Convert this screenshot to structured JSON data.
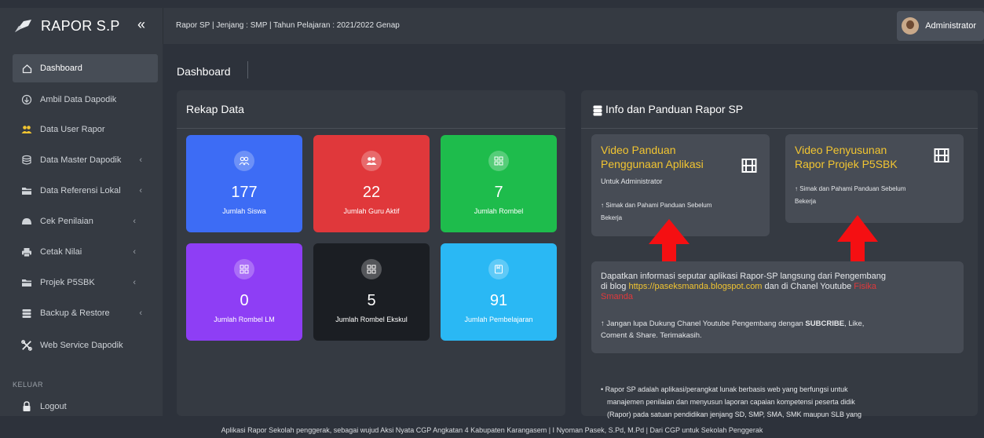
{
  "app": {
    "name": "RAPOR S.P",
    "collapse_icon": "«"
  },
  "header": {
    "info": "Rapor SP | Jenjang : SMP | Tahun Pelajaran : 2021/2022 Genap",
    "user": "Administrator"
  },
  "sidebar": {
    "items": [
      {
        "label": "Dashboard",
        "icon": "home-icon",
        "chev": ""
      },
      {
        "label": "Ambil Data Dapodik",
        "icon": "download-icon",
        "chev": ""
      },
      {
        "label": "Data User Rapor",
        "icon": "users-icon",
        "chev": ""
      },
      {
        "label": "Data Master Dapodik",
        "icon": "database-icon",
        "chev": "‹"
      },
      {
        "label": "Data Referensi Lokal",
        "icon": "folder-icon",
        "chev": "‹"
      },
      {
        "label": "Cek Penilaian",
        "icon": "check-icon",
        "chev": "‹"
      },
      {
        "label": "Cetak Nilai",
        "icon": "print-icon",
        "chev": "‹"
      },
      {
        "label": "Projek P5SBK",
        "icon": "project-icon",
        "chev": "‹"
      },
      {
        "label": "Backup & Restore",
        "icon": "backup-icon",
        "chev": "‹"
      },
      {
        "label": "Web Service Dapodik",
        "icon": "tools-icon",
        "chev": ""
      }
    ],
    "section_label": "KELUAR",
    "logout": "Logout"
  },
  "page": {
    "title": "Dashboard"
  },
  "rekap": {
    "title": "Rekap Data",
    "stats": [
      {
        "value": "177",
        "label": "Jumlah Siswa",
        "color": "#3d6cf5"
      },
      {
        "value": "22",
        "label": "Jumlah Guru Aktif",
        "color": "#e0383b"
      },
      {
        "value": "7",
        "label": "Jumlah Rombel",
        "color": "#1ebc4c"
      },
      {
        "value": "0",
        "label": "Jumlah Rombel LM",
        "color": "#8e3ef5"
      },
      {
        "value": "5",
        "label": "Jumlah Rombel Ekskul",
        "color": "#1b1e23"
      },
      {
        "value": "91",
        "label": "Jumlah Pembelajaran",
        "color": "#2ab8f4"
      }
    ]
  },
  "info": {
    "title": "Info dan Panduan Rapor SP",
    "video1": {
      "title_line1": "Video Panduan",
      "title_line2": "Penggunaan Aplikasi",
      "sub": "Untuk Administrator",
      "note_line1": "↑ Simak dan Pahami Panduan Sebelum",
      "note_line2": "Bekerja"
    },
    "video2": {
      "title_line1": "Video Penyusunan",
      "title_line2": "Rapor Projek P5SBK",
      "note_line1": "↑ Simak dan Pahami Panduan Sebelum",
      "note_line2": "Bekerja"
    },
    "blog": {
      "line1": "Dapatkan informasi seputar aplikasi Rapor-SP langsung dari Pengembang",
      "line2_pre": "di blog ",
      "link": "https://paseksmanda.blogspot.com",
      "line2_mid": " dan di Chanel Youtube ",
      "channel_1": "Fisika",
      "channel_2": "Smanda",
      "note_pre": "↑ Jangan lupa Dukung Chanel Youtube Pengembang dengan ",
      "note_bold": "SUBCRIBE",
      "note_post": ", Like,",
      "note_line2": "Coment & Share. Terimakasih."
    },
    "desc": [
      "• Rapor SP adalah aplikasi/perangkat lunak berbasis web yang berfungsi untuk",
      "manajemen penilaian dan menyusun laporan capaian kompetensi peserta didik",
      "(Rapor) pada satuan pendidikan jenjang SD, SMP, SMA, SMK maupun SLB yang"
    ]
  },
  "footer": "Aplikasi Rapor Sekolah penggerak, sebagai wujud Aksi Nyata CGP Angkatan 4 Kabupaten Karangasem | I Nyoman Pasek, S.Pd, M.Pd | Dari CGP untuk Sekolah Penggerak"
}
